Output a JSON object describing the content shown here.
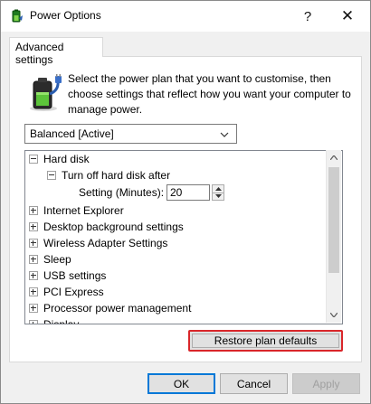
{
  "window": {
    "title": "Power Options",
    "help_glyph": "?",
    "close_glyph": "✕"
  },
  "tabs": [
    {
      "label": "Advanced settings",
      "active": true
    }
  ],
  "description": "Select the power plan that you want to customise, then choose settings that reflect how you want your computer to manage power.",
  "plan_select": {
    "value": "Balanced [Active]",
    "icon": "chevron-down-icon"
  },
  "tree": {
    "items": [
      {
        "label": "Hard disk",
        "expanded": true,
        "level": 0
      },
      {
        "label": "Turn off hard disk after",
        "expanded": true,
        "level": 1
      },
      {
        "label": "Setting (Minutes):",
        "value": "20",
        "level": 2
      },
      {
        "label": "Internet Explorer",
        "expanded": false,
        "level": 0
      },
      {
        "label": "Desktop background settings",
        "expanded": false,
        "level": 0
      },
      {
        "label": "Wireless Adapter Settings",
        "expanded": false,
        "level": 0
      },
      {
        "label": "Sleep",
        "expanded": false,
        "level": 0
      },
      {
        "label": "USB settings",
        "expanded": false,
        "level": 0
      },
      {
        "label": "PCI Express",
        "expanded": false,
        "level": 0
      },
      {
        "label": "Processor power management",
        "expanded": false,
        "level": 0
      },
      {
        "label": "Display",
        "expanded": false,
        "level": 0
      }
    ]
  },
  "buttons": {
    "restore": "Restore plan defaults",
    "ok": "OK",
    "cancel": "Cancel",
    "apply": "Apply"
  },
  "colors": {
    "highlight": "#d9262a",
    "focus": "#0078d7"
  }
}
